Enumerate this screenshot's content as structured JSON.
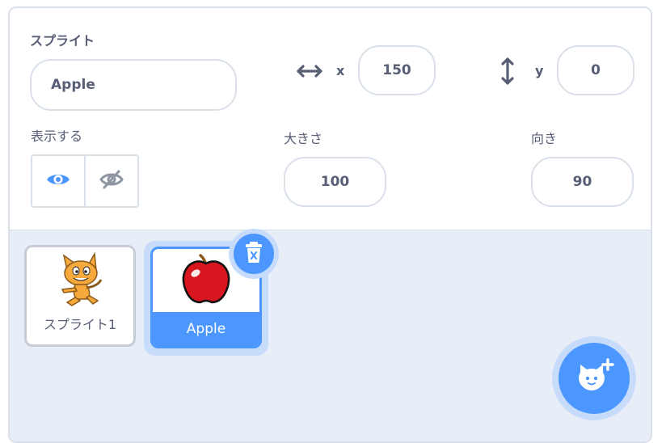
{
  "sprite_info": {
    "sprite_label": "スプライト",
    "sprite_name": "Apple",
    "x_label": "x",
    "x_value": "150",
    "y_label": "y",
    "y_value": "0",
    "show_label": "表示する",
    "size_label": "大きさ",
    "size_value": "100",
    "direction_label": "向き",
    "direction_value": "90"
  },
  "sprite_list": {
    "items": [
      {
        "name": "スプライト1",
        "selected": false
      },
      {
        "name": "Apple",
        "selected": true
      }
    ]
  },
  "colors": {
    "accent": "#4c97ff",
    "text": "#575e75",
    "border": "#d9e0ea",
    "tray_bg": "#e8eef7"
  }
}
